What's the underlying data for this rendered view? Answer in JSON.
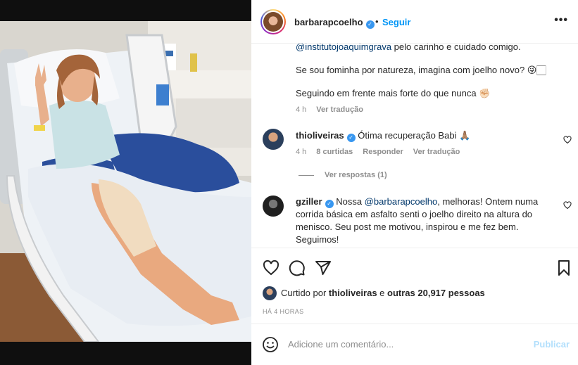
{
  "post": {
    "username": "barbarapcoelho",
    "dot": "•",
    "follow_label": "Seguir",
    "more_label": "•••"
  },
  "caption": {
    "mention": "@institutojoaquimgrava",
    "line1_rest": " pelo carinho e cuidado comigo.",
    "line2": "Se sou fominha por natureza, imagina com joelho novo? 😜🏻",
    "line3": "Seguindo em frente mais forte do que nunca ✊🏻",
    "time": "4 h",
    "translate": "Ver tradução"
  },
  "comments": [
    {
      "username": "thioliveiras",
      "text": "Ótima recuperação Babi 🙏🏽",
      "time": "4 h",
      "likes": "8 curtidas",
      "reply": "Responder",
      "translate": "Ver tradução",
      "view_replies": "Ver respostas (1)"
    },
    {
      "username": "gziller",
      "text_before": "Nossa ",
      "mention": "@barbarapcoelho",
      "text_after": ", melhoras! Ontem numa",
      "line2": "corrida básica em asfalto senti o joelho direito na altura do",
      "line3": "menisco. Seu post me motivou, inspirou e me fez bem.",
      "line4": "Seguimos!"
    }
  ],
  "likes": {
    "prefix": "Curtido por ",
    "user": "thioliveiras",
    "middle": " e ",
    "others": "outras 20,917 pessoas"
  },
  "timestamp": "HÁ 4 HORAS",
  "add_comment": {
    "placeholder": "Adicione um comentário...",
    "publish_label": "Publicar"
  },
  "colors": {
    "link_blue": "#0095f6",
    "verified_blue": "#3897f0",
    "muted": "#8e8e8e",
    "publish_disabled": "#b2dffc"
  }
}
